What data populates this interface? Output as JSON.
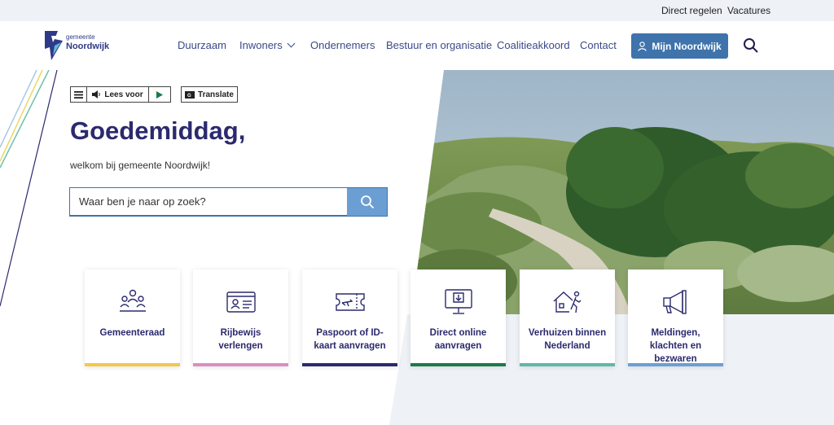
{
  "topbar": {
    "links": [
      "Direct regelen",
      "Vacatures"
    ]
  },
  "logo": {
    "small": "gemeente",
    "big": "Noordwijk"
  },
  "nav": {
    "items": [
      "Duurzaam",
      "Inwoners",
      "Ondernemers",
      "Bestuur en organisatie",
      "Coalitieakkoord",
      "Contact"
    ],
    "login_button": "Mijn Noordwijk"
  },
  "toolbar": {
    "read_aloud": "Lees voor",
    "translate": "Translate"
  },
  "hero": {
    "greeting": "Goedemiddag,",
    "welcome": "welkom bij gemeente Noordwijk!",
    "search_placeholder": "Waar ben je naar op zoek?"
  },
  "cards": [
    {
      "label": "Gemeenteraad",
      "icon": "council-icon",
      "color": "#f2c94c"
    },
    {
      "label": "Rijbewijs verlengen",
      "icon": "id-card-icon",
      "color": "#d98fc2"
    },
    {
      "label": "Paspoort of ID-kaart aanvragen",
      "icon": "passport-icon",
      "color": "#2b2a6e"
    },
    {
      "label": "Direct online aanvragen",
      "icon": "monitor-download-icon",
      "color": "#1b7a4a"
    },
    {
      "label": "Verhuizen binnen Nederland",
      "icon": "moving-house-icon",
      "color": "#5fb8a8"
    },
    {
      "label": "Meldingen, klachten en bezwaren",
      "icon": "megaphone-icon",
      "color": "#6b9fd4"
    }
  ],
  "colors": {
    "primary": "#2b2a6e",
    "button": "#3f73ab",
    "search_button": "#6b9fd4",
    "band": "#eef2f7"
  }
}
